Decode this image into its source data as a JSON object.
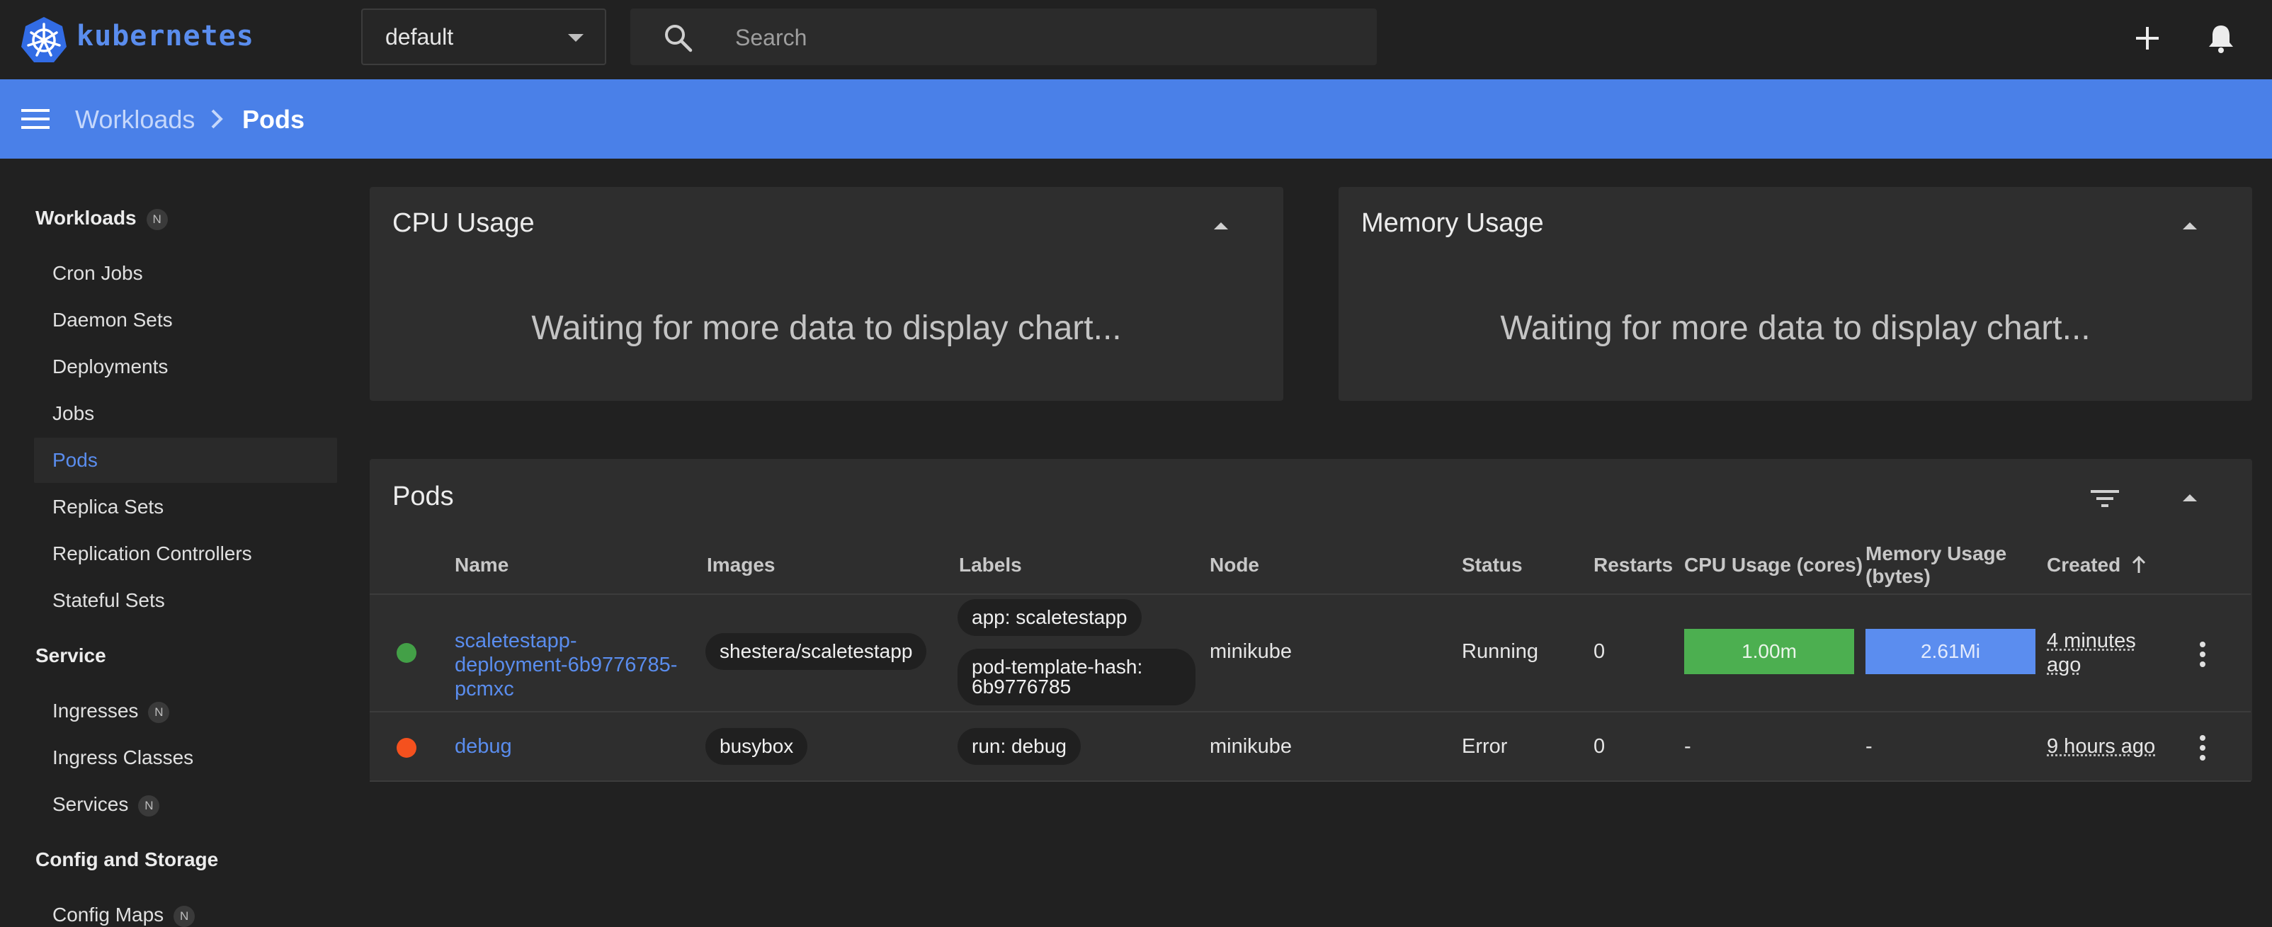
{
  "app": {
    "brand": "kubernetes"
  },
  "namespace": {
    "selected": "default"
  },
  "search": {
    "placeholder": "Search"
  },
  "breadcrumb": {
    "parent": "Workloads",
    "current": "Pods"
  },
  "sidebar": {
    "sections": [
      {
        "title": "Workloads",
        "badge": "N",
        "items": [
          "Cron Jobs",
          "Daemon Sets",
          "Deployments",
          "Jobs",
          "Pods",
          "Replica Sets",
          "Replication Controllers",
          "Stateful Sets"
        ]
      },
      {
        "title": "Service",
        "items": [
          "Ingresses",
          "Ingress Classes",
          "Services"
        ]
      },
      {
        "title": "Config and Storage",
        "items": [
          "Config Maps"
        ]
      }
    ],
    "badge": "N",
    "active_item": "Pods"
  },
  "cpu_card": {
    "title": "CPU Usage",
    "message": "Waiting for more data to display chart..."
  },
  "memory_card": {
    "title": "Memory Usage",
    "message": "Waiting for more data to display chart..."
  },
  "pods": {
    "title": "Pods",
    "columns": [
      "Name",
      "Images",
      "Labels",
      "Node",
      "Status",
      "Restarts",
      "CPU Usage (cores)",
      "Memory Usage (bytes)",
      "Created"
    ],
    "rows": [
      {
        "status_color": "#43a047",
        "name": "scaletestapp-deployment-6b9776785-pcmxc",
        "image": "shestera/scaletestapp",
        "labels": [
          "app: scaletestapp",
          "pod-template-hash: 6b9776785"
        ],
        "node": "minikube",
        "status": "Running",
        "restarts": "0",
        "cpu": "1.00m",
        "memory": "2.61Mi",
        "created": "4 minutes ago"
      },
      {
        "status_color": "#f4511e",
        "name": "debug",
        "image": "busybox",
        "labels": [
          "run: debug"
        ],
        "node": "minikube",
        "status": "Error",
        "restarts": "0",
        "cpu": "-",
        "memory": "-",
        "created": "9 hours ago"
      }
    ]
  },
  "colors": {
    "accent": "#4a80e8",
    "link": "#5a8dee",
    "cpu_bar": "#4caf50",
    "memory_bar": "#5b8def"
  }
}
